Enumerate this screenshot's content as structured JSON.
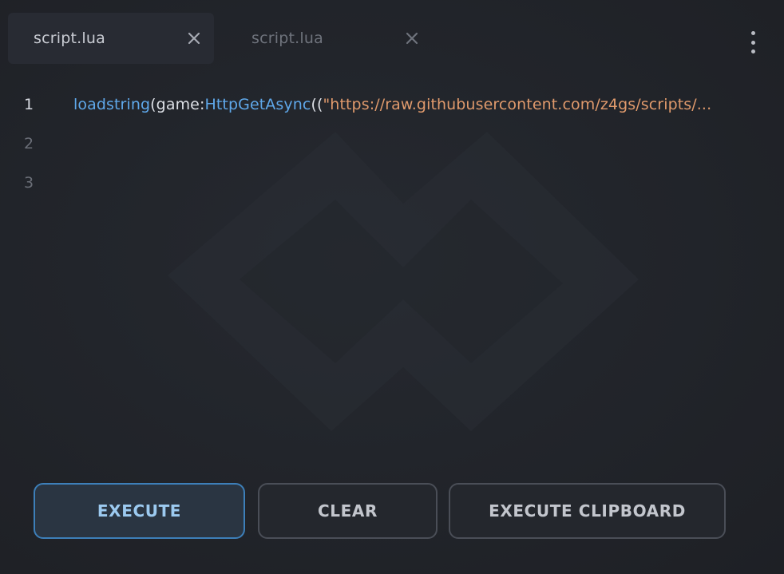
{
  "tabs": [
    {
      "label": "script.lua",
      "active": true,
      "close_icon": "close-icon"
    },
    {
      "label": "script.lua",
      "active": false,
      "close_icon": "close-icon"
    }
  ],
  "menu": {
    "icon": "kebab-menu-icon"
  },
  "editor": {
    "lines": [
      {
        "number": "1",
        "tokens": {
          "t1": "loadstring",
          "t2": "(game:",
          "t3": "HttpGetAsync",
          "t4": "((",
          "t5": "\"https://raw.githubusercontent.com/z4gs/scripts/..."
        }
      },
      {
        "number": "2"
      },
      {
        "number": "3"
      }
    ]
  },
  "buttons": {
    "execute": "EXECUTE",
    "clear": "CLEAR",
    "execute_clipboard": "EXECUTE CLIPBOARD"
  },
  "colors": {
    "accent": "#3d7fb9",
    "function": "#5fa8ea",
    "string": "#e09a6c",
    "background": "#22252b"
  },
  "watermark": {
    "icon": "logo-watermark-icon"
  }
}
